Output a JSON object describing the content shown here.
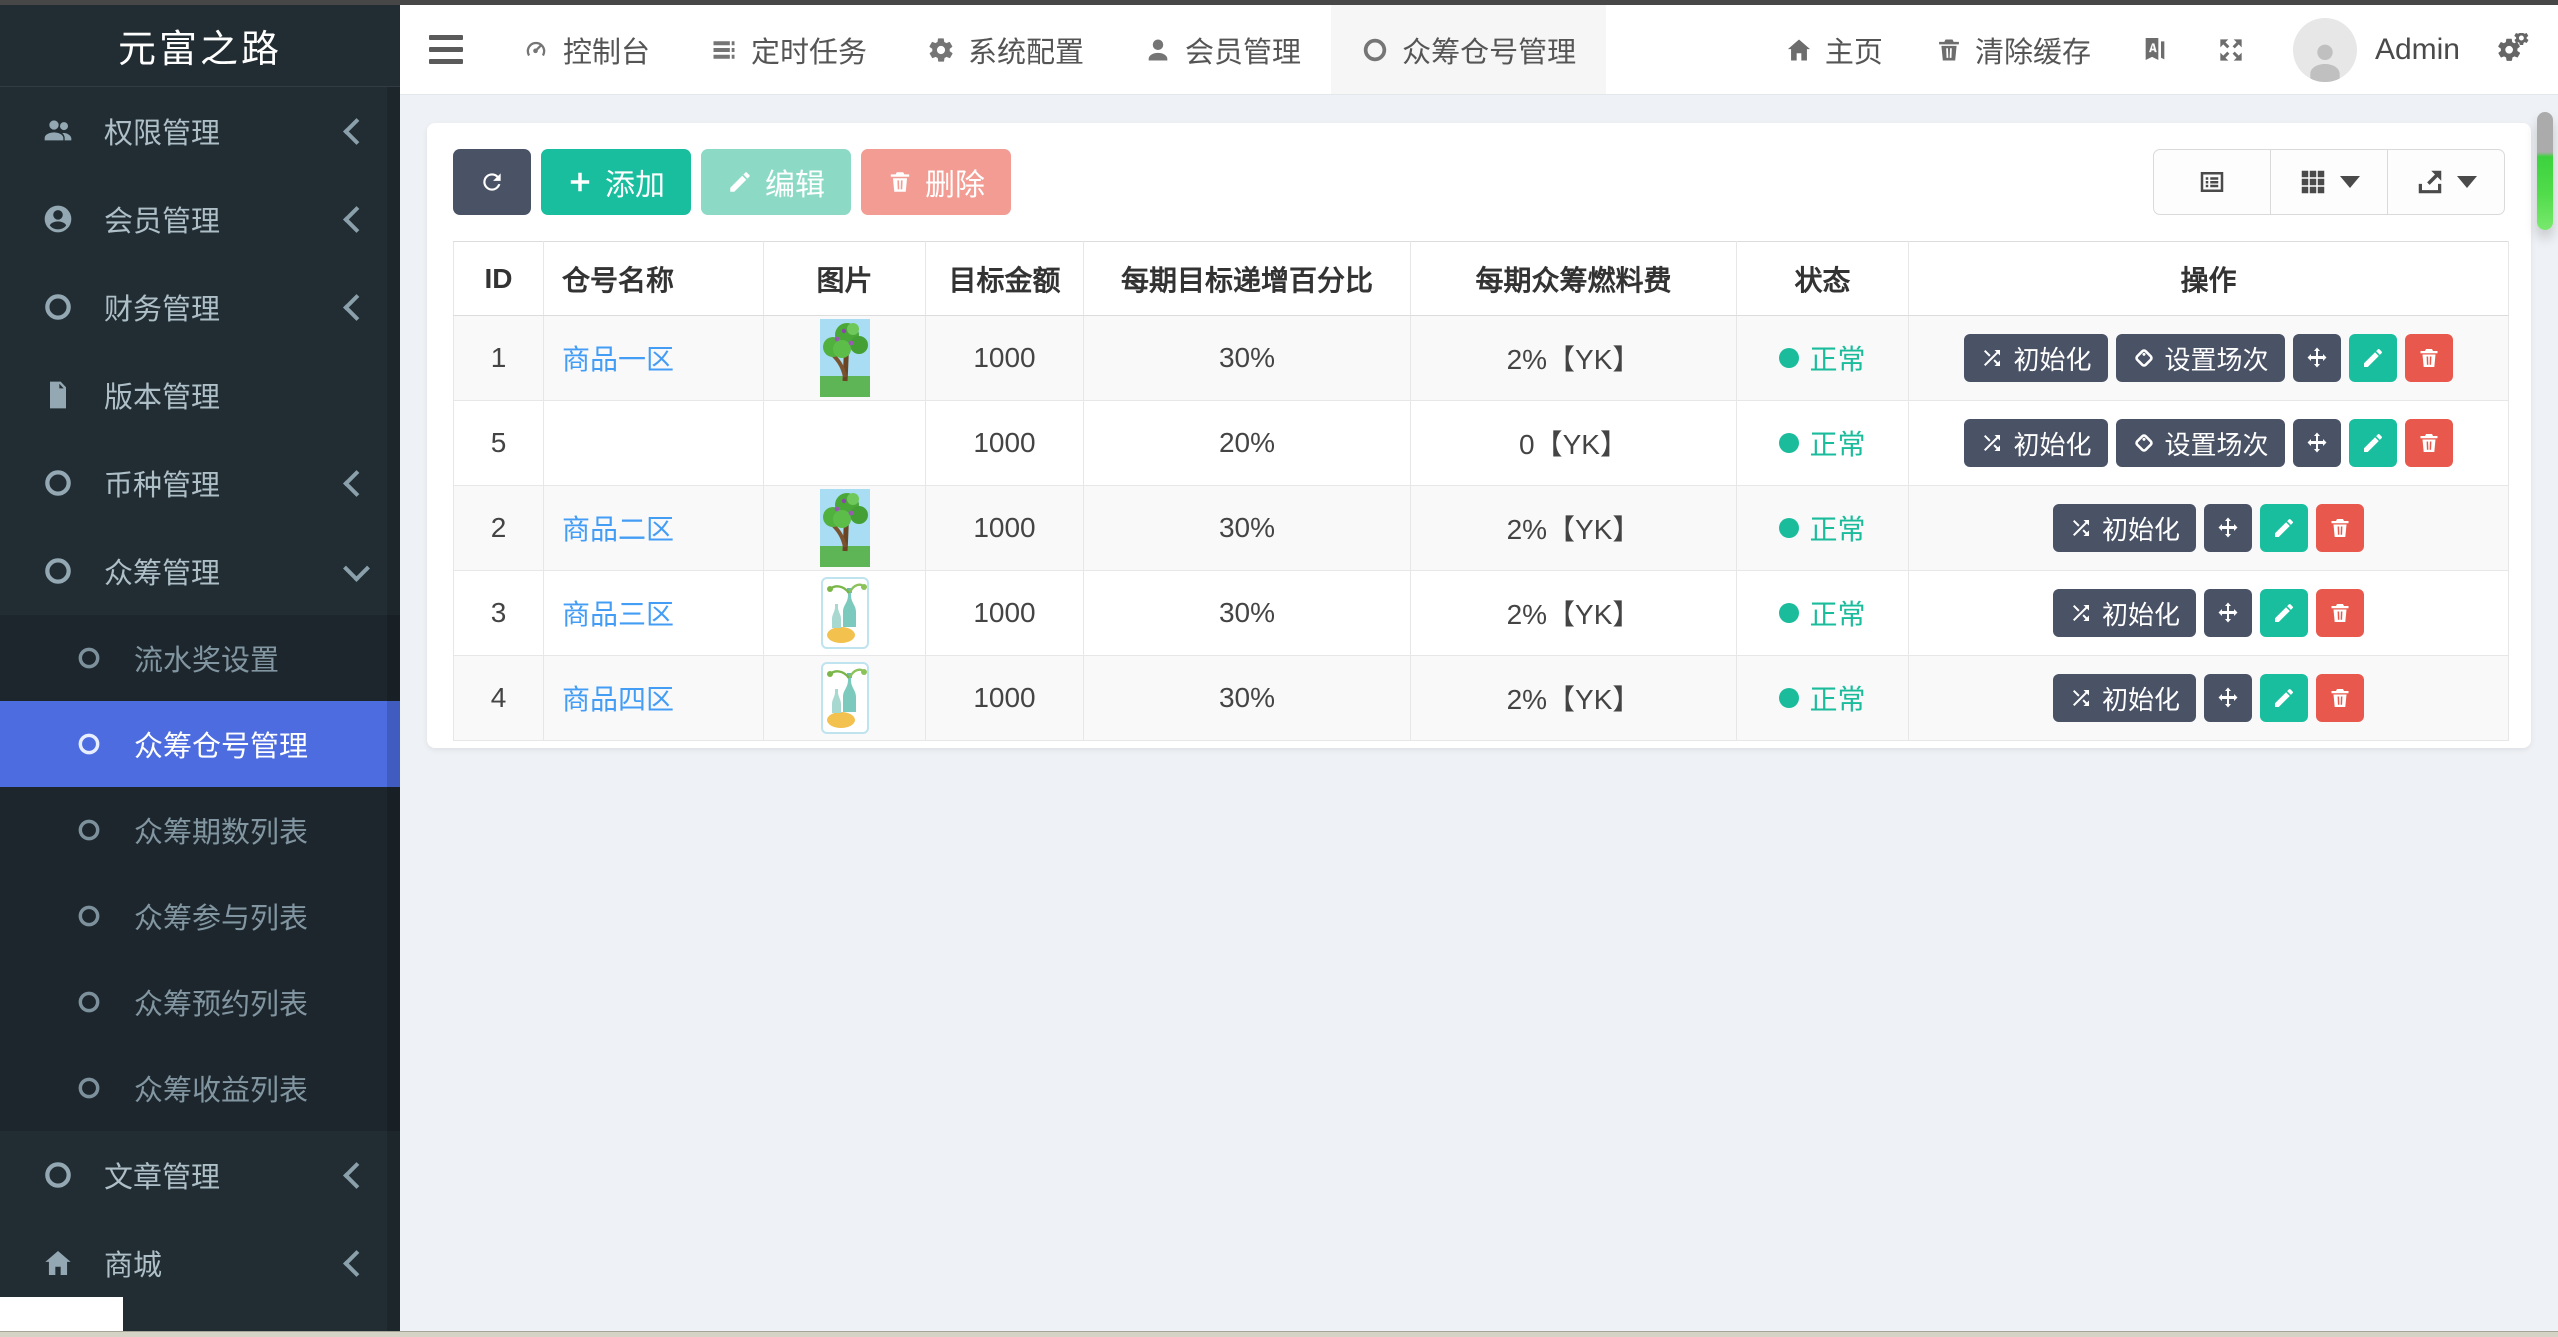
{
  "brand": {
    "title": "元富之路"
  },
  "topnav": {
    "tabs": [
      {
        "label": "控制台",
        "icon": "gauge-icon",
        "active": false
      },
      {
        "label": "定时任务",
        "icon": "tasks-icon",
        "active": false
      },
      {
        "label": "系统配置",
        "icon": "gear-icon",
        "active": false
      },
      {
        "label": "会员管理",
        "icon": "user-icon",
        "active": false
      },
      {
        "label": "众筹仓号管理",
        "icon": "circle-icon",
        "active": true
      }
    ],
    "right_links": [
      {
        "label": "主页",
        "icon": "home-icon"
      },
      {
        "label": "清除缓存",
        "icon": "trash-icon"
      }
    ],
    "icon_buttons": [
      {
        "name": "language-button",
        "icon": "language-icon"
      },
      {
        "name": "fullscreen-button",
        "icon": "fullscreen-icon"
      }
    ],
    "user": {
      "name": "Admin"
    }
  },
  "sidebar": {
    "items": [
      {
        "label": "权限管理",
        "icon": "users-icon",
        "chevron": "left"
      },
      {
        "label": "会员管理",
        "icon": "user-circle-icon",
        "chevron": "left"
      },
      {
        "label": "财务管理",
        "icon": "circle-icon",
        "chevron": "left"
      },
      {
        "label": "版本管理",
        "icon": "file-icon",
        "chevron": "none"
      },
      {
        "label": "币种管理",
        "icon": "circle-icon",
        "chevron": "left"
      },
      {
        "label": "众筹管理",
        "icon": "circle-icon",
        "chevron": "down",
        "expanded": true,
        "children": [
          {
            "label": "流水奖设置",
            "active": false
          },
          {
            "label": "众筹仓号管理",
            "active": true
          },
          {
            "label": "众筹期数列表",
            "active": false
          },
          {
            "label": "众筹参与列表",
            "active": false
          },
          {
            "label": "众筹预约列表",
            "active": false
          },
          {
            "label": "众筹收益列表",
            "active": false
          }
        ]
      },
      {
        "label": "文章管理",
        "icon": "circle-icon",
        "chevron": "left"
      },
      {
        "label": "商城",
        "icon": "home-icon",
        "chevron": "left"
      }
    ]
  },
  "toolbar": {
    "buttons": [
      {
        "name": "refresh-button",
        "label": "",
        "icon": "refresh-icon",
        "style": "dark"
      },
      {
        "name": "add-button",
        "label": "添加",
        "icon": "plus-icon",
        "style": "success"
      },
      {
        "name": "edit-button",
        "label": "编辑",
        "icon": "pencil-icon",
        "style": "success-dis"
      },
      {
        "name": "delete-button",
        "label": "删除",
        "icon": "trash-icon",
        "style": "danger-dis"
      }
    ],
    "view_buttons": [
      {
        "name": "detail-view-button",
        "icon": "list-view-icon",
        "caret": false
      },
      {
        "name": "columns-view-button",
        "icon": "grid-view-icon",
        "caret": true
      },
      {
        "name": "export-button",
        "icon": "export-icon",
        "caret": true
      }
    ]
  },
  "table": {
    "columns": [
      {
        "key": "id",
        "label": "ID"
      },
      {
        "key": "name",
        "label": "仓号名称"
      },
      {
        "key": "image",
        "label": "图片"
      },
      {
        "key": "amount",
        "label": "目标金额"
      },
      {
        "key": "increase",
        "label": "每期目标递增百分比"
      },
      {
        "key": "fuel",
        "label": "每期众筹燃料费"
      },
      {
        "key": "status",
        "label": "状态"
      },
      {
        "key": "ops",
        "label": "操作"
      }
    ],
    "action_labels": {
      "init": "初始化",
      "sessions": "设置场次"
    },
    "rows": [
      {
        "id": "1",
        "name": "商品一区",
        "image": "tree",
        "amount": "1000",
        "increase": "30%",
        "fuel": "2%【YK】",
        "status": "正常",
        "actions": [
          "init",
          "sessions",
          "move",
          "edit",
          "delete"
        ]
      },
      {
        "id": "5",
        "name": "",
        "image": "none",
        "amount": "1000",
        "increase": "20%",
        "fuel": "0【YK】",
        "status": "正常",
        "actions": [
          "init",
          "sessions",
          "move",
          "edit",
          "delete"
        ]
      },
      {
        "id": "2",
        "name": "商品二区",
        "image": "tree",
        "amount": "1000",
        "increase": "30%",
        "fuel": "2%【YK】",
        "status": "正常",
        "actions": [
          "init",
          "move",
          "edit",
          "delete"
        ]
      },
      {
        "id": "3",
        "name": "商品三区",
        "image": "vase",
        "amount": "1000",
        "increase": "30%",
        "fuel": "2%【YK】",
        "status": "正常",
        "actions": [
          "init",
          "move",
          "edit",
          "delete"
        ]
      },
      {
        "id": "4",
        "name": "商品四区",
        "image": "vase",
        "amount": "1000",
        "increase": "30%",
        "fuel": "2%【YK】",
        "status": "正常",
        "actions": [
          "init",
          "move",
          "edit",
          "delete"
        ]
      }
    ]
  },
  "colors": {
    "sidebar_bg": "#222d33",
    "submenu_bg": "#1c262c",
    "active_blue": "#4c6ce0",
    "link": "#449df5",
    "success": "#19be9e",
    "danger": "#e8584c",
    "dark_button": "#4a5266",
    "status_green": "#1abc9c"
  }
}
